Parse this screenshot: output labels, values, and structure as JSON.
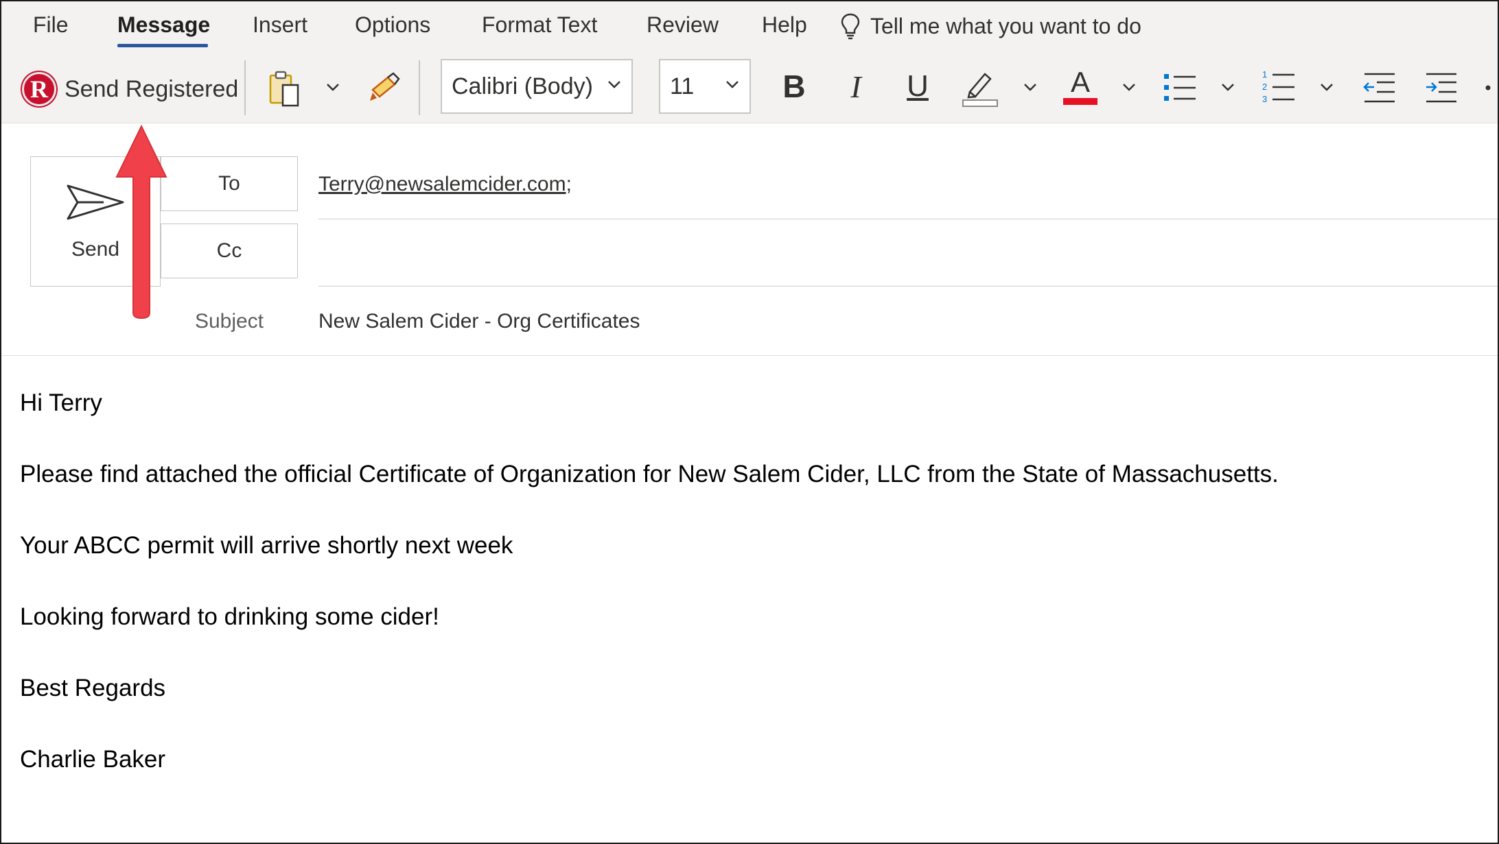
{
  "ribbon": {
    "tabs": [
      {
        "label": "File"
      },
      {
        "label": "Message",
        "active": true
      },
      {
        "label": "Insert"
      },
      {
        "label": "Options"
      },
      {
        "label": "Format Text"
      },
      {
        "label": "Review"
      },
      {
        "label": "Help"
      }
    ],
    "tell_me": "Tell me what you want to do",
    "accent_color": "#2b579a"
  },
  "toolbar": {
    "send_registered_label": "Send Registered",
    "send_registered_logo": "R",
    "font_name": "Calibri (Body)",
    "font_size": "11",
    "bold_label": "B",
    "italic_label": "I",
    "underline_label": "U",
    "font_color_label": "A",
    "font_color": "#e81123",
    "icons": [
      "paste-icon",
      "format-painter-icon",
      "highlight-icon",
      "bullets-icon",
      "numbering-icon",
      "decrease-indent-icon",
      "increase-indent-icon"
    ]
  },
  "header": {
    "send_label": "Send",
    "to_label": "To",
    "cc_label": "Cc",
    "to_value": "Terry@newsalemcider.com",
    "to_separator": ";",
    "cc_value": "",
    "subject_label": "Subject",
    "subject_value": "New Salem Cider - Org Certificates"
  },
  "body": {
    "lines": [
      "Hi Terry",
      "Please find attached the official Certificate of Organization for New Salem Cider, LLC from the State of Massachusetts.",
      "Your ABCC permit will arrive shortly next week",
      "Looking forward to drinking some cider!",
      "Best Regards",
      "Charlie Baker"
    ]
  },
  "annotation": {
    "arrow_color": "#f0404a"
  }
}
